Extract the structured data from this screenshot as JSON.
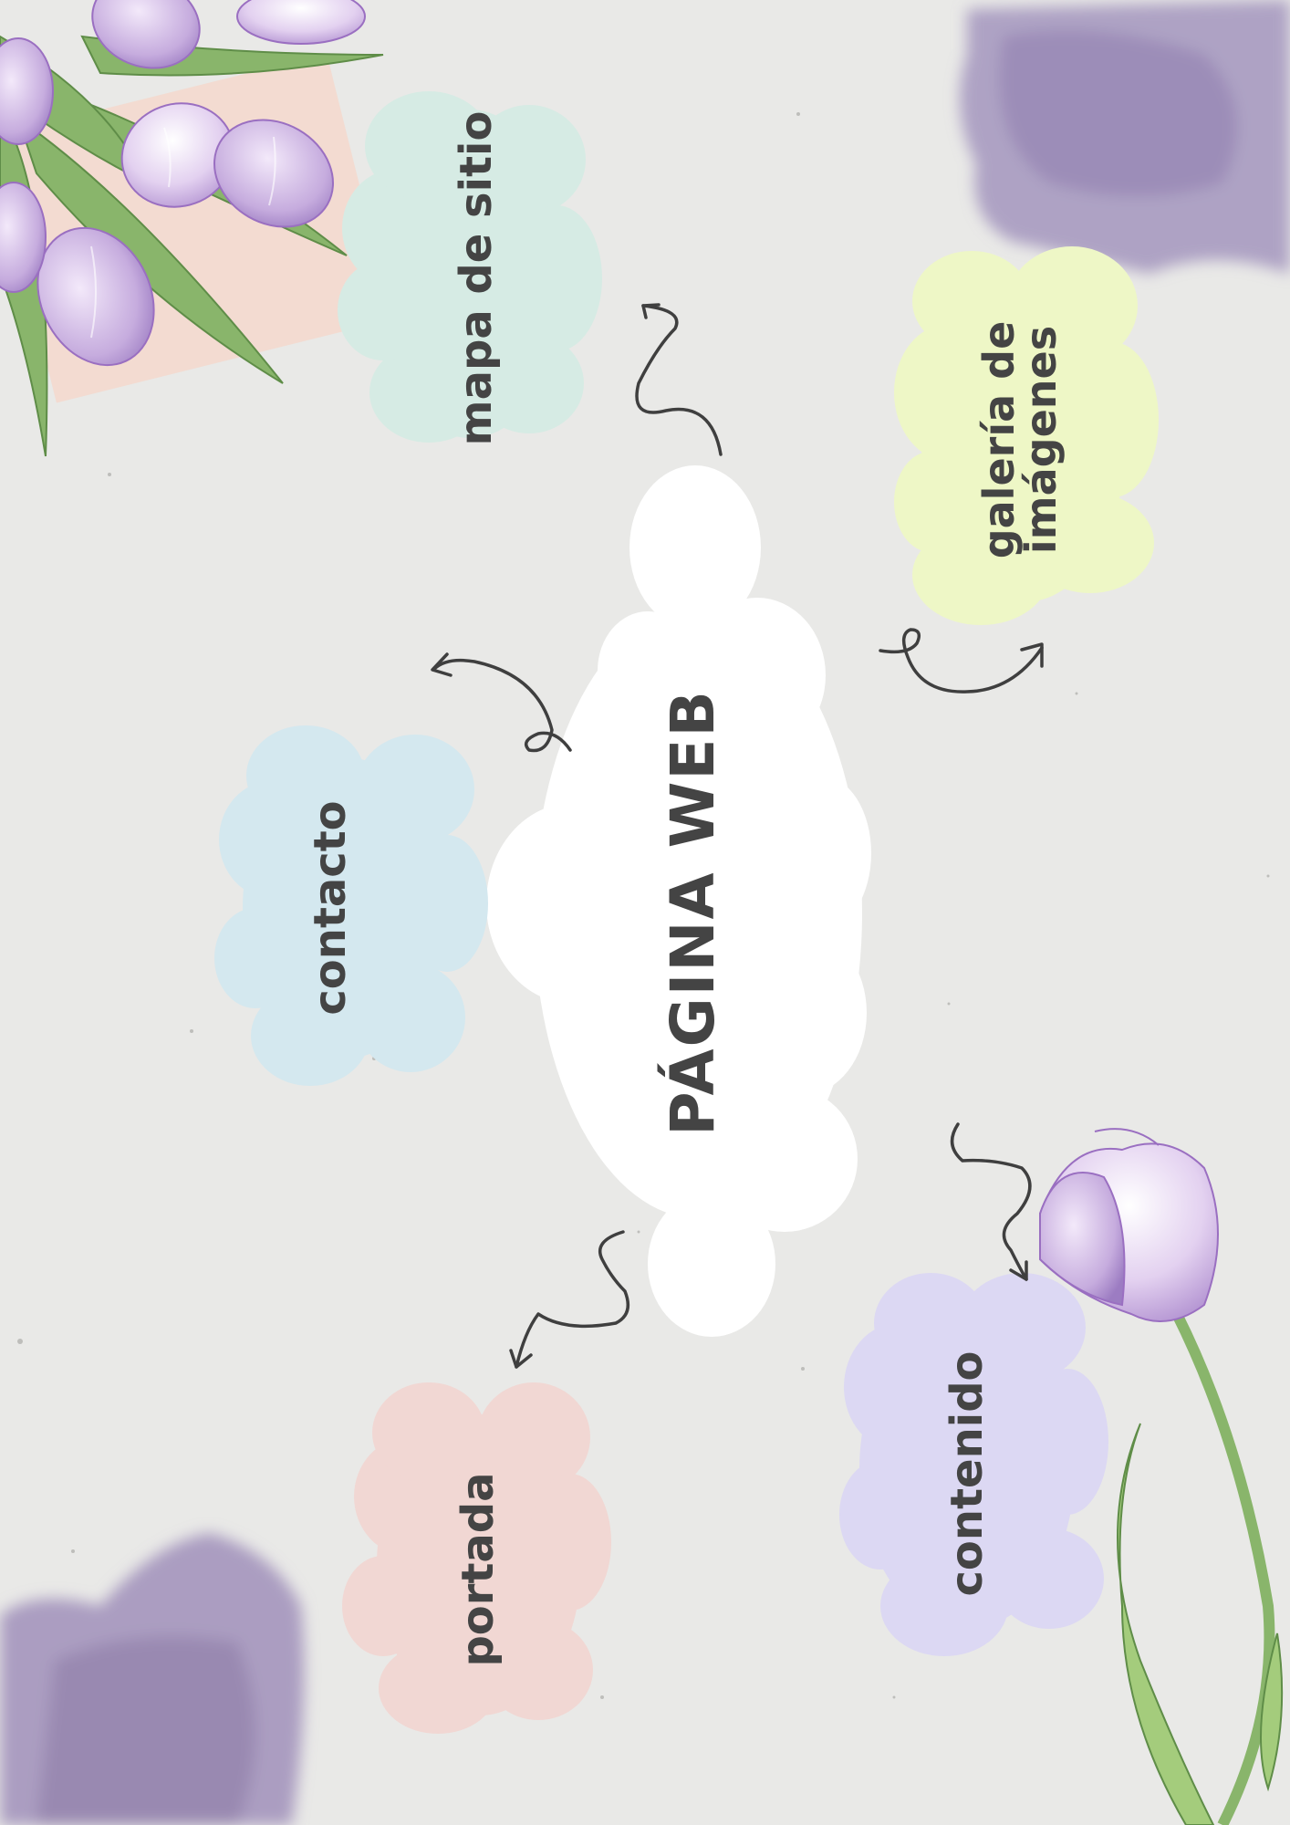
{
  "center": {
    "title": "PÁGINA WEB",
    "color": "#ffffff"
  },
  "nodes": [
    {
      "id": "mapa",
      "label": "mapa de sitio",
      "color": "#d6ebe4"
    },
    {
      "id": "galeria",
      "label": "galería de imágenes",
      "line1": "galería de",
      "line2": "imágenes",
      "color": "#eef7c6"
    },
    {
      "id": "contacto",
      "label": "contacto",
      "color": "#d4e8ef"
    },
    {
      "id": "contenido",
      "label": "contenido",
      "color": "#dcd8f3"
    },
    {
      "id": "portada",
      "label": "portada",
      "color": "#f1d7d3"
    }
  ],
  "colors": {
    "background": "#e9e9e7",
    "text": "#444444",
    "arrow": "#3f3f3f",
    "watercolor": "#9b8bb8",
    "tulip_petal": "#c6acde",
    "tulip_leaf": "#89b56b"
  },
  "decorations": [
    "tulip-bouquet",
    "single-tulip",
    "watercolor-stain"
  ]
}
